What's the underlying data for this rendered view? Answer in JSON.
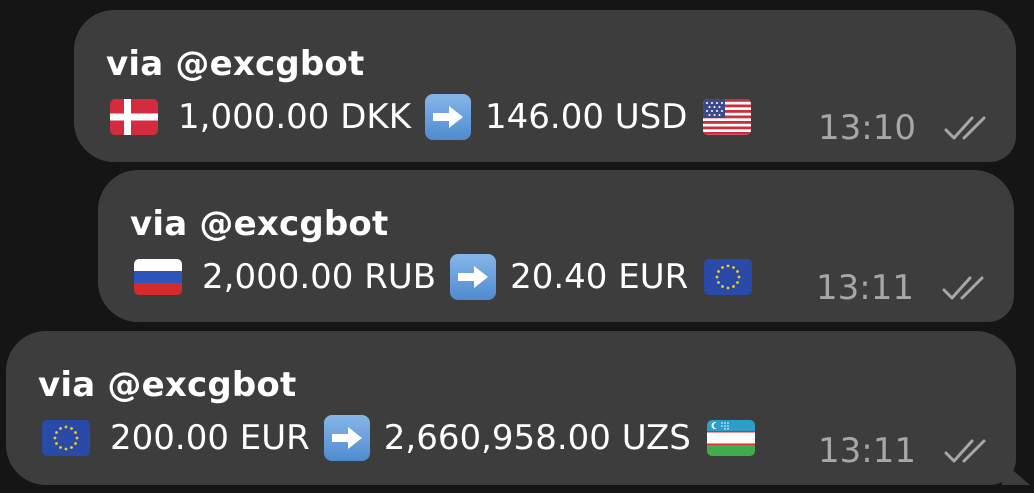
{
  "messages": [
    {
      "via": "via @excgbot",
      "from_flag": "denmark-flag-icon",
      "from_amount": "1,000.00 DKK",
      "arrow": "right-arrow-icon",
      "to_amount": "146.00 USD",
      "to_flag": "usa-flag-icon",
      "time": "13:10",
      "status": "read-double-check-icon"
    },
    {
      "via": "via @excgbot",
      "from_flag": "russia-flag-icon",
      "from_amount": "2,000.00 RUB",
      "arrow": "right-arrow-icon",
      "to_amount": "20.40 EUR",
      "to_flag": "eu-flag-icon",
      "time": "13:11",
      "status": "read-double-check-icon"
    },
    {
      "via": "via @excgbot",
      "from_flag": "eu-flag-icon",
      "from_amount": "200.00 EUR",
      "arrow": "right-arrow-icon",
      "to_amount": "2,660,958.00 UZS",
      "to_flag": "uzbekistan-flag-icon",
      "time": "13:11",
      "status": "read-double-check-icon"
    }
  ],
  "colors": {
    "background": "#151515",
    "bubble": "#3d3d3d",
    "text": "#ffffff",
    "meta": "#a7a7a7",
    "arrow_box": "#5f9ad8"
  }
}
